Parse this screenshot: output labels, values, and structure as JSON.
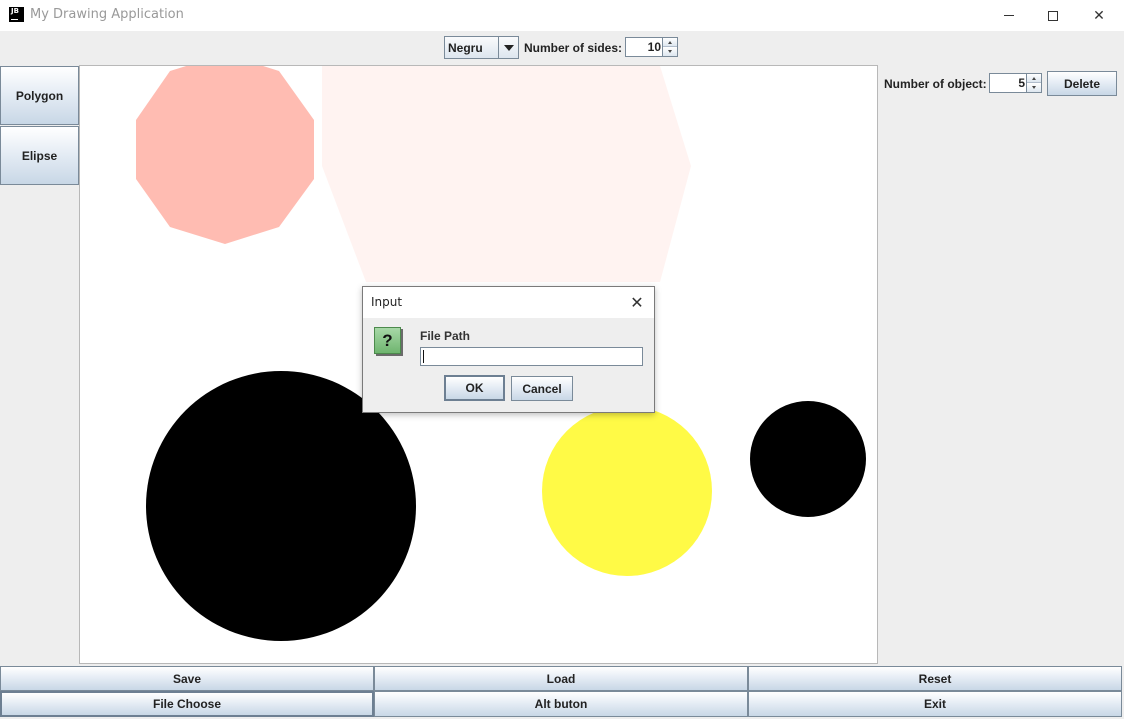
{
  "window": {
    "icon_text": "JB",
    "title": "My Drawing Application",
    "minimize_icon": "minimize-icon",
    "maximize_icon": "maximize-icon",
    "close_icon": "close-icon"
  },
  "toolbar": {
    "color_select_value": "Negru",
    "sides_label": "Number of sides:",
    "sides_value": "10"
  },
  "left_panel": {
    "polygon_label": "Polygon",
    "elipse_label": "Elipse"
  },
  "right_panel": {
    "objects_label": "Number of object:",
    "objects_value": "5",
    "delete_label": "Delete"
  },
  "canvas": {
    "shape_colors": {
      "decagon": "#ffbcb2",
      "hexagon": "#fff3f1",
      "circle_large": "#000000",
      "circle_yellow": "#fffa46",
      "circle_small": "#000000"
    }
  },
  "dialog": {
    "title": "Input",
    "prompt": "File Path",
    "input_value": "",
    "ok_label": "OK",
    "cancel_label": "Cancel",
    "icon": "question-icon"
  },
  "bottom_buttons": {
    "save": "Save",
    "load": "Load",
    "reset": "Reset",
    "file_choose": "File Choose",
    "alt_button": "Alt buton",
    "exit": "Exit"
  }
}
